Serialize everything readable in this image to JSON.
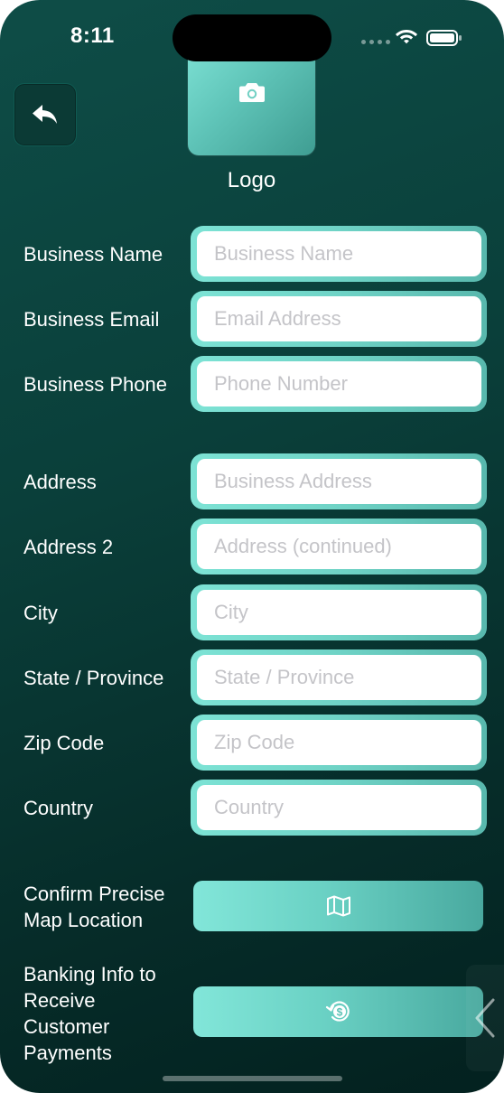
{
  "status_bar": {
    "time": "8:11"
  },
  "header": {
    "back_icon": "reply-arrow-icon",
    "logo_icon": "camera-icon",
    "logo_label": "Logo"
  },
  "business": {
    "name": {
      "label": "Business Name",
      "placeholder": "Business Name",
      "value": ""
    },
    "email": {
      "label": "Business Email",
      "placeholder": "Email Address",
      "value": ""
    },
    "phone": {
      "label": "Business Phone",
      "placeholder": "Phone Number",
      "value": ""
    }
  },
  "address": {
    "line1": {
      "label": "Address",
      "placeholder": "Business Address",
      "value": ""
    },
    "line2": {
      "label": "Address 2",
      "placeholder": "Address (continued)",
      "value": ""
    },
    "city": {
      "label": "City",
      "placeholder": "City",
      "value": ""
    },
    "state": {
      "label": "State / Province",
      "placeholder": "State / Province",
      "value": ""
    },
    "zip": {
      "label": "Zip Code",
      "placeholder": "Zip Code",
      "value": ""
    },
    "country": {
      "label": "Country",
      "placeholder": "Country",
      "value": ""
    }
  },
  "actions": {
    "map": {
      "label_line1": "Confirm Precise",
      "label_line2": "Map Location",
      "icon": "map-icon"
    },
    "banking": {
      "label_line1": "Banking Info to",
      "label_line2": "Receive",
      "label_line3": "Customer",
      "label_line4": "Payments",
      "icon": "dollar-refresh-icon"
    }
  },
  "side_tab": {
    "icon": "chevron-left-icon"
  },
  "colors": {
    "background_dark": "#03211f",
    "background_light": "#0e4d47",
    "accent": "#6fd3c6",
    "accent_light": "#82e6d9",
    "accent_dark": "#49a99f",
    "placeholder_text": "#c4c4c8"
  }
}
